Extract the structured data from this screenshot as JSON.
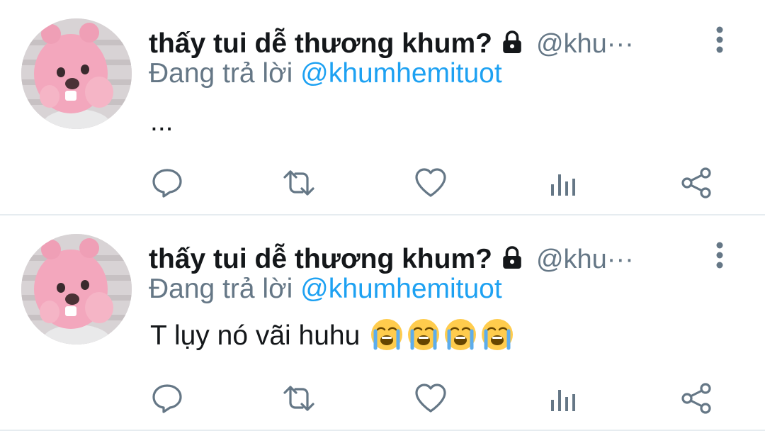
{
  "tweets": [
    {
      "display_name": "thấy tui dễ thương khum?",
      "handle": "@khu···",
      "reply_prefix": "Đang trả lời ",
      "reply_to": "@khumhemituot",
      "text": "...",
      "emoji_count": 0
    },
    {
      "display_name": "thấy tui dễ thương khum?",
      "handle": "@khu···",
      "reply_prefix": "Đang trả lời ",
      "reply_to": "@khumhemituot",
      "text": "T lụy nó vãi huhu ",
      "emoji_count": 4
    }
  ],
  "icons": {
    "lock": "lock-icon",
    "more": "more-vertical-icon",
    "reply": "reply-icon",
    "retweet": "retweet-icon",
    "like": "heart-icon",
    "analytics": "analytics-icon",
    "share": "share-icon",
    "emoji": "loudly-crying-face-emoji"
  },
  "colors": {
    "name": "#14171a",
    "muted": "#657786",
    "mention": "#1da1f2",
    "icon": "#657786",
    "divider": "#e6ecf0"
  }
}
